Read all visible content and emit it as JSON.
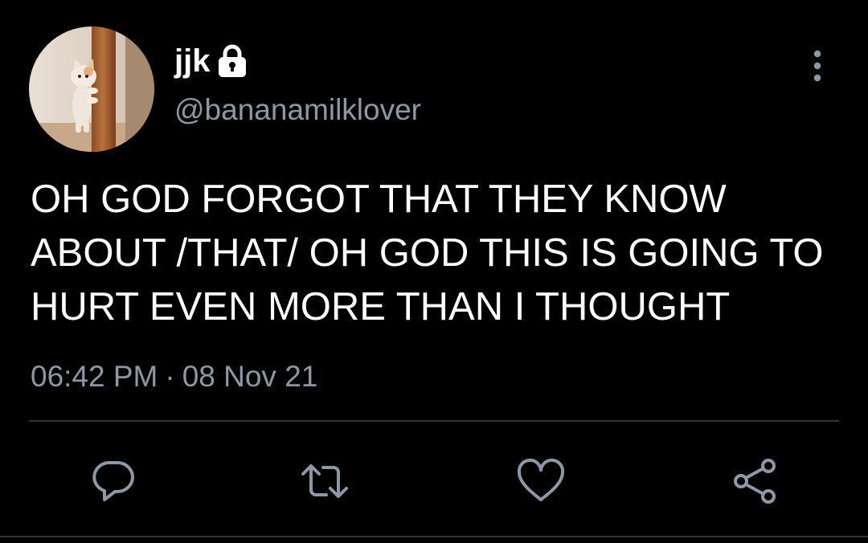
{
  "colors": {
    "background": "#000000",
    "primary_text": "#ffffff",
    "secondary_text": "#8b98a5",
    "divider": "#2f3336"
  },
  "user": {
    "display_name": "jjk",
    "handle": "@bananamilklover",
    "avatar_icon": "avatar-cat-peeking-photo",
    "protected_icon": "lock-icon"
  },
  "tweet": {
    "text": "OH GOD FORGOT THAT THEY KNOW ABOUT /THAT/ OH GOD THIS IS GOING TO HURT EVEN MORE THAN I THOUGHT",
    "time": "06:42 PM",
    "separator": "·",
    "date": "08 Nov 21"
  },
  "actions": [
    {
      "name": "reply",
      "icon": "reply-icon"
    },
    {
      "name": "retweet",
      "icon": "retweet-icon"
    },
    {
      "name": "like",
      "icon": "heart-icon"
    },
    {
      "name": "share",
      "icon": "share-icon"
    }
  ],
  "menu": {
    "icon": "more-vertical-icon"
  }
}
